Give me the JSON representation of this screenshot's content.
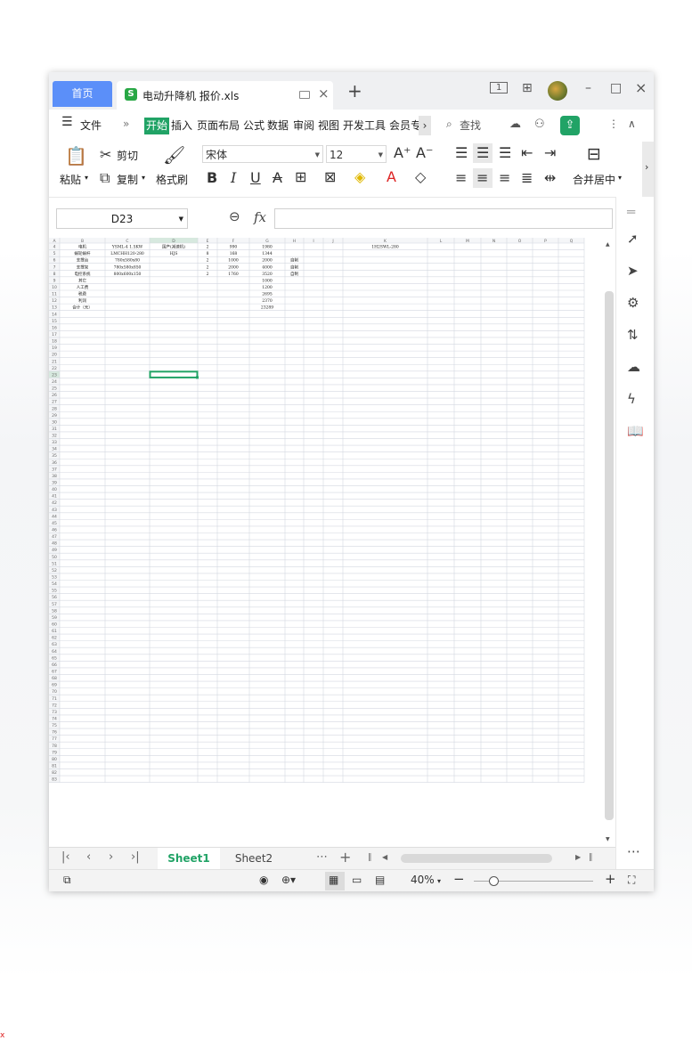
{
  "titlebar": {
    "home_tab": "首页",
    "doc_tab": "电动升降机 报价.xls",
    "new_tab": "+",
    "badge": "1",
    "minimize": "–",
    "maximize": "□",
    "close": "×"
  },
  "menubar": {
    "file": "文件",
    "items": [
      "开始",
      "插入",
      "页面布局",
      "公式",
      "数据",
      "审阅",
      "视图",
      "开发工具",
      "会员专"
    ],
    "search": "查找"
  },
  "ribbon": {
    "paste": "粘贴",
    "cut": "剪切",
    "copy": "复制",
    "format_painter": "格式刷",
    "font_name": "宋体",
    "font_size": "12",
    "merge_center": "合并居中"
  },
  "formula_bar": {
    "name_box": "D23",
    "fx": "fx",
    "value": ""
  },
  "grid": {
    "columns": [
      "A",
      "B",
      "C",
      "D",
      "E",
      "F",
      "G",
      "H",
      "I",
      "J",
      "K",
      "L",
      "M",
      "N",
      "O",
      "P",
      "Q"
    ],
    "first_row": 4,
    "last_row": 83,
    "selected_cell": "D23",
    "rows": [
      {
        "r": 4,
        "B": "电机",
        "C": "YSML-4 1.5KW",
        "D": "国产(减速机)",
        "E": "2",
        "F": "990",
        "G": "1980",
        "H": "",
        "K": "1H2SWL-280"
      },
      {
        "r": 5,
        "B": "蜗轮蜗杆",
        "C": "LMCHH120-280",
        "D": "HJS",
        "E": "8",
        "F": "168",
        "G": "1344",
        "H": "",
        "K": ""
      },
      {
        "r": 6,
        "B": "支撑台",
        "C": "780x580x80",
        "D": "",
        "E": "2",
        "F": "1000",
        "G": "2000",
        "H": "自制",
        "K": ""
      },
      {
        "r": 7,
        "B": "支撑架",
        "C": "780x580x850",
        "D": "",
        "E": "2",
        "F": "2000",
        "G": "4000",
        "H": "自制",
        "K": ""
      },
      {
        "r": 8,
        "B": "电控系统",
        "C": "800x600x150",
        "D": "",
        "E": "2",
        "F": "1760",
        "G": "3520",
        "H": "自制",
        "K": ""
      },
      {
        "r": 9,
        "B": "其它",
        "C": "",
        "D": "",
        "E": "",
        "F": "",
        "G": "1000",
        "H": "",
        "K": ""
      },
      {
        "r": 10,
        "B": "人工费",
        "C": "",
        "D": "",
        "E": "",
        "F": "",
        "G": "1200",
        "H": "",
        "K": ""
      },
      {
        "r": 11,
        "B": "税费",
        "C": "",
        "D": "",
        "E": "",
        "F": "",
        "G": "2695",
        "H": "",
        "K": ""
      },
      {
        "r": 12,
        "B": "利润",
        "C": "",
        "D": "",
        "E": "",
        "F": "",
        "G": "2370",
        "H": "",
        "K": ""
      },
      {
        "r": 13,
        "B": "合计（元）",
        "C": "",
        "D": "",
        "E": "",
        "F": "",
        "G": "23289",
        "H": "",
        "K": ""
      }
    ]
  },
  "sheet_tabs": {
    "sheet1": "Sheet1",
    "sheet2": "Sheet2",
    "more": "⋯",
    "add": "+"
  },
  "statusbar": {
    "zoom": "40%",
    "zoom_level": 0.4,
    "minus": "−",
    "plus": "+"
  },
  "colors": {
    "accent_green": "#21a366",
    "home_tab_blue": "#5b8ff9",
    "gridline": "#d4d8e0",
    "selected_border": "#21a366"
  }
}
